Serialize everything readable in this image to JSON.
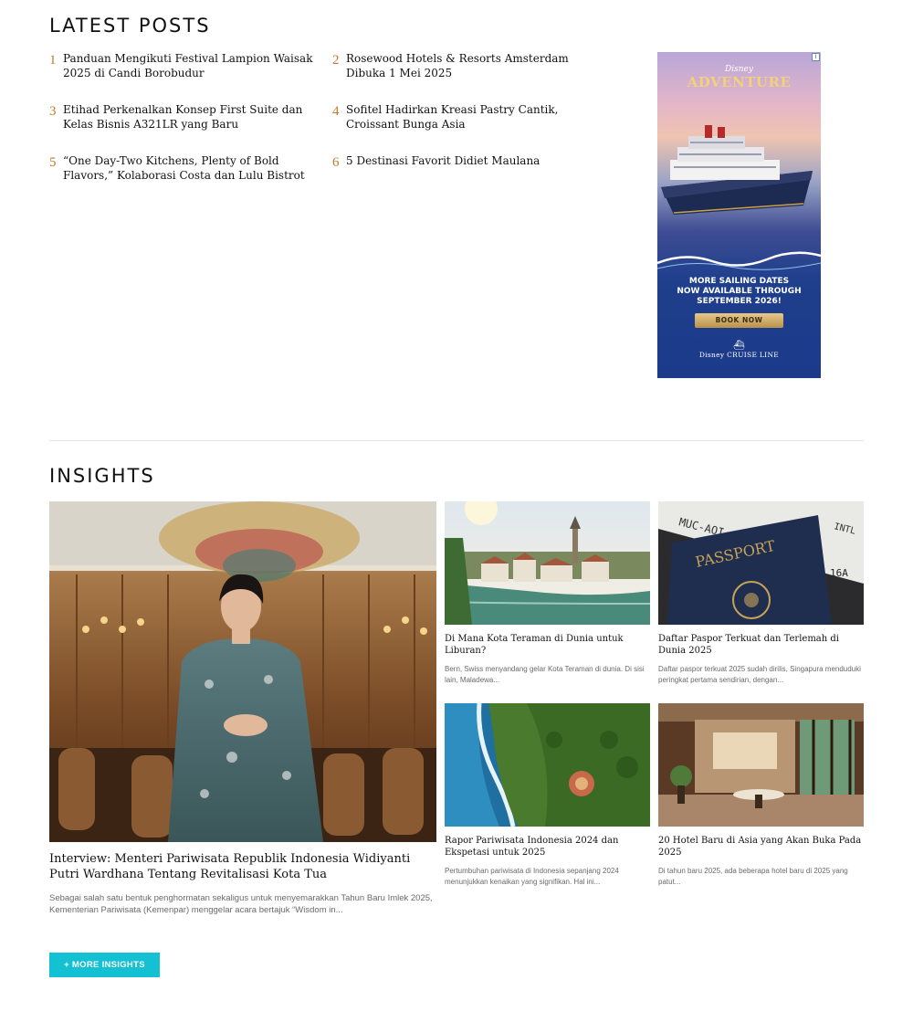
{
  "latest": {
    "title": "LATEST POSTS",
    "posts": [
      {
        "num": "1",
        "title": "Panduan Mengikuti Festival Lampion Waisak 2025 di Candi Borobudur"
      },
      {
        "num": "2",
        "title": "Rosewood Hotels & Resorts Amsterdam Dibuka 1 Mei 2025"
      },
      {
        "num": "3",
        "title": "Etihad Perkenalkan Konsep First Suite dan Kelas Bisnis A321LR yang Baru"
      },
      {
        "num": "4",
        "title": "Sofitel Hadirkan Kreasi Pastry Cantik, Croissant Bunga Asia"
      },
      {
        "num": "5",
        "title": "“One Day-Two Kitchens, Plenty of Bold Flavors,” Kolaborasi Costa dan Lulu Bistrot"
      },
      {
        "num": "6",
        "title": "5 Destinasi Favorit Didiet Maulana"
      }
    ]
  },
  "ad": {
    "brand_small": "Disney",
    "brand_big": "ADVENTURE",
    "line1": "MORE SAILING DATES",
    "line2": "NOW AVAILABLE THROUGH",
    "line3": "SEPTEMBER 2026!",
    "button": "BOOK NOW",
    "logo_line": "Disney CRUISE LINE",
    "badge": "i"
  },
  "insights": {
    "title": "INSIGHTS",
    "hero": {
      "title": "Interview: Menteri Pariwisata Republik Indonesia Widiyanti Putri Wardhana Tentang Revitalisasi Kota Tua",
      "excerpt": "Sebagai salah satu bentuk penghormatan sekaligus untuk menyemarakkan Tahun Baru Imlek 2025, Kementerian Pariwisata (Kemenpar) menggelar acara bertajuk “Wisdom in..."
    },
    "cards": [
      {
        "title": "Di Mana Kota Teraman di Dunia untuk Liburan?",
        "excerpt": "Bern, Swiss menyandang gelar Kota Teraman di dunia. Di sisi lain, Maladewa..."
      },
      {
        "title": "Daftar Paspor Terkuat dan Terlemah di Dunia 2025",
        "excerpt": "Daftar paspor terkuat 2025 sudah dirilis, Singapura menduduki peringkat pertama sendirian, dengan..."
      },
      {
        "title": "Rapor Pariwisata Indonesia 2024 dan Ekspetasi untuk 2025",
        "excerpt": "Pertumbuhan pariwisata di Indonesia sepanjang 2024 menunjukkan kenaikan yang signifikan. Hal ini..."
      },
      {
        "title": "20 Hotel Baru di Asia yang Akan Buka Pada 2025",
        "excerpt": "Di tahun baru 2025, ada beberapa hotel baru di 2025 yang patut..."
      }
    ],
    "passport_text": {
      "word": "PASSPORT",
      "ticket_code": "MUC-AOI",
      "intl": "INTL",
      "seat": "16A"
    },
    "more_button": "+ MORE INSIGHTS"
  }
}
